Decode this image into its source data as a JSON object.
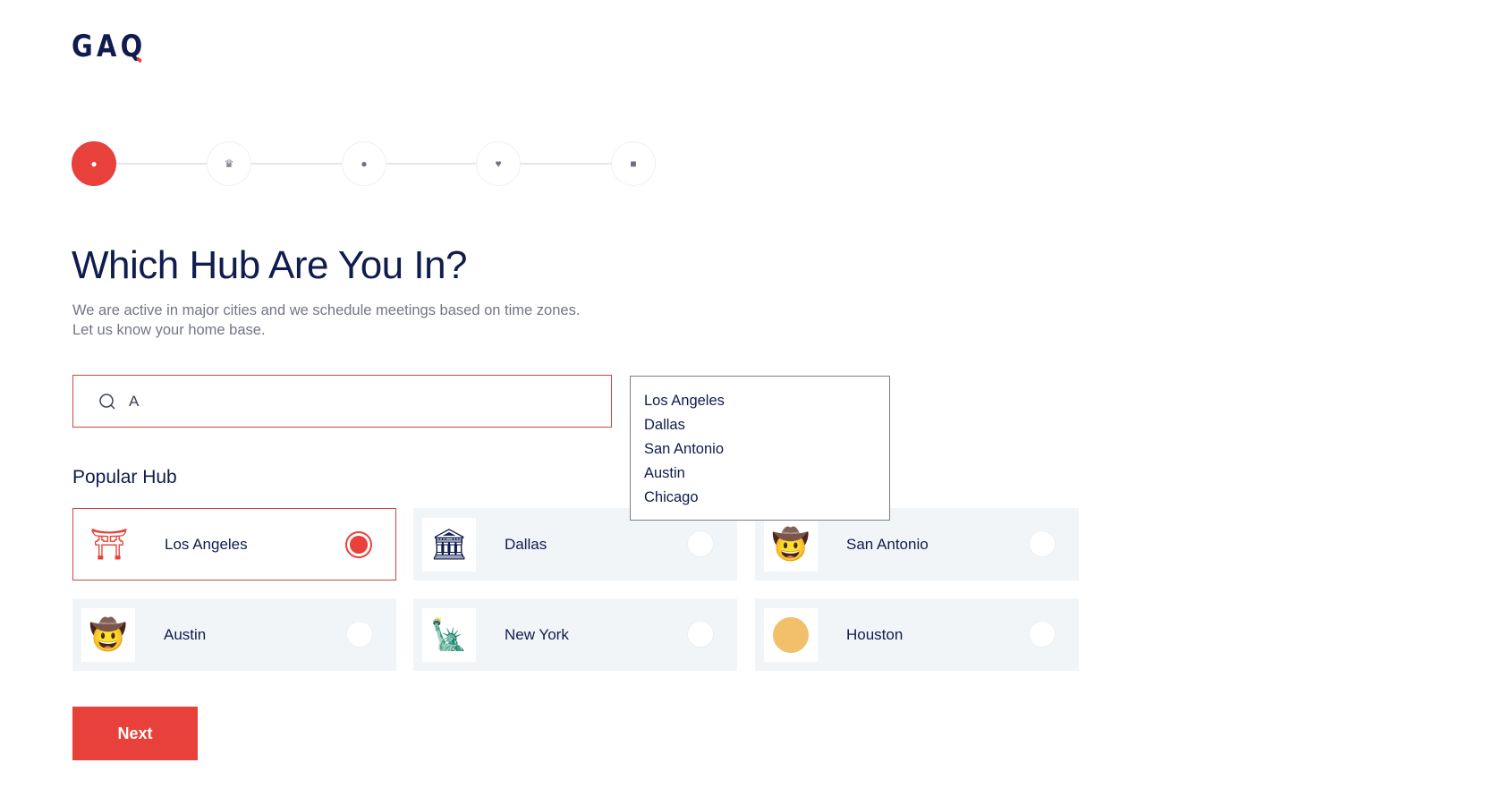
{
  "logo": {
    "text": "GAQ"
  },
  "stepper": {
    "steps": [
      {
        "icon": "map-pin-icon",
        "active": true
      },
      {
        "icon": "crown-icon"
      },
      {
        "icon": "person-icon"
      },
      {
        "icon": "heart-icon"
      },
      {
        "icon": "badge-icon"
      }
    ]
  },
  "page": {
    "title": "Which Hub Are You In?",
    "subtitle_line1": "We are active in major cities and we schedule meetings based on time zones.",
    "subtitle_line2": "Let us know your home base."
  },
  "search": {
    "value": "A",
    "placeholder": ""
  },
  "dropdown": {
    "options": [
      "Los Angeles",
      "Dallas",
      "San Antonio",
      "Austin",
      "Chicago"
    ]
  },
  "popular": {
    "heading": "Popular Hub",
    "hubs": [
      {
        "name": "Los Angeles",
        "icon": "golden-gate-bridge-icon",
        "selected": true
      },
      {
        "name": "Dallas",
        "icon": "alamo-building-icon",
        "selected": false
      },
      {
        "name": "San Antonio",
        "icon": "cowboy-bandit-icon",
        "selected": false
      },
      {
        "name": "Austin",
        "icon": "cowboy-icon",
        "selected": false
      },
      {
        "name": "New York",
        "icon": "statue-of-liberty-icon",
        "selected": false
      },
      {
        "name": "Houston",
        "icon": "texas-map-icon",
        "selected": false
      }
    ]
  },
  "actions": {
    "next_label": "Next"
  },
  "colors": {
    "accent": "#e8403a",
    "navy": "#0f1c4d",
    "card_bg": "#f2f5f8"
  }
}
